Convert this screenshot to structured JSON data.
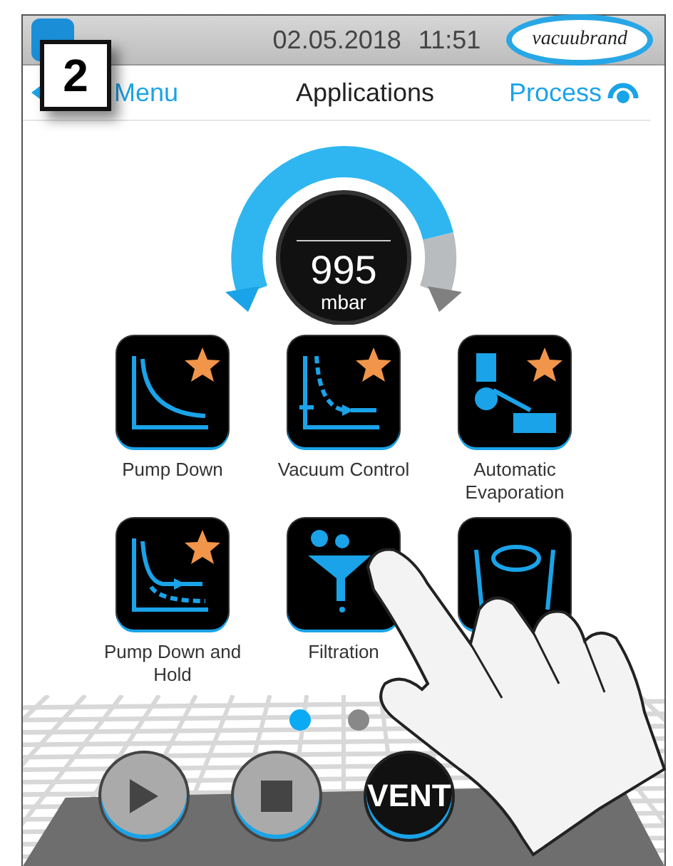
{
  "status_bar": {
    "date": "02.05.2018",
    "time": "11:51",
    "logo": "vacuubrand"
  },
  "step_badge": "2",
  "nav": {
    "back": "Menu",
    "title": "Applications",
    "process": "Process"
  },
  "gauge": {
    "value": "995",
    "unit": "mbar"
  },
  "apps": [
    {
      "kind": "pump-down",
      "label": "Pump Down",
      "starred": true
    },
    {
      "kind": "vacuum-control",
      "label": "Vacuum Control",
      "starred": true
    },
    {
      "kind": "evaporation",
      "label": "Automatic Evaporation",
      "starred": true
    },
    {
      "kind": "pump-down-hold",
      "label": "Pump Down and Hold",
      "starred": true
    },
    {
      "kind": "filtration",
      "label": "Filtration",
      "starred": false
    },
    {
      "kind": "rotary",
      "starred": false
    }
  ],
  "page_dots": [
    {
      "selected": true
    },
    {
      "selected": false
    }
  ],
  "controls": [
    {
      "kind": "play",
      "disabled": true
    },
    {
      "kind": "stop",
      "disabled": true
    },
    {
      "kind": "vent",
      "label": "VENT",
      "disabled": false
    }
  ]
}
